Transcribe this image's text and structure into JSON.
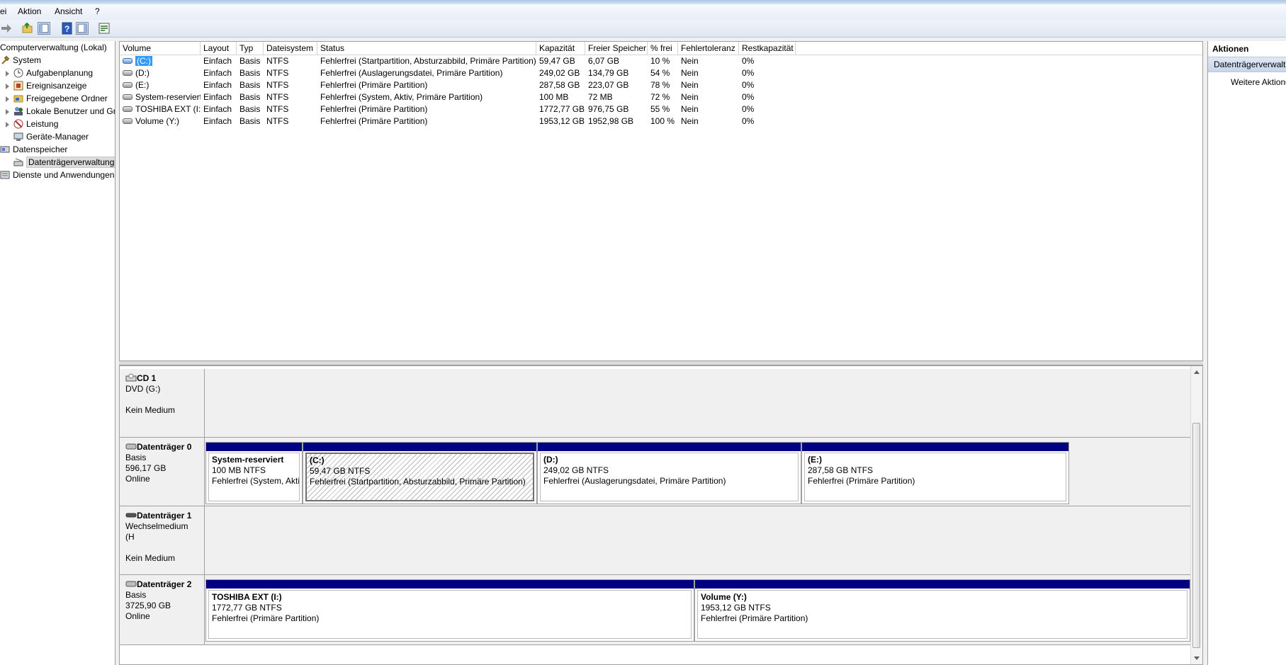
{
  "menu": [
    "ei",
    "Aktion",
    "Ansicht",
    "?"
  ],
  "tree": {
    "items": [
      {
        "label": "Computerverwaltung (Lokal)",
        "level": 0,
        "expander": false,
        "icon": "computer-icon"
      },
      {
        "label": "System",
        "level": 1,
        "expander": false,
        "icon": "tools-icon"
      },
      {
        "label": "Aufgabenplanung",
        "level": 2,
        "expander": true,
        "icon": "clock-icon"
      },
      {
        "label": "Ereignisanzeige",
        "level": 2,
        "expander": true,
        "icon": "event-log-icon"
      },
      {
        "label": "Freigegebene Ordner",
        "level": 2,
        "expander": true,
        "icon": "shared-folder-icon"
      },
      {
        "label": "Lokale Benutzer und Gru",
        "level": 2,
        "expander": true,
        "icon": "users-icon"
      },
      {
        "label": "Leistung",
        "level": 2,
        "expander": true,
        "icon": "performance-icon"
      },
      {
        "label": "Geräte-Manager",
        "level": 2,
        "expander": false,
        "icon": "device-manager-icon"
      },
      {
        "label": "Datenspeicher",
        "level": 1,
        "expander": false,
        "icon": "storage-icon"
      },
      {
        "label": "Datenträgerverwaltung",
        "level": 2,
        "expander": false,
        "icon": "disk-management-icon",
        "selected": true
      },
      {
        "label": "Dienste und Anwendungen",
        "level": 1,
        "expander": false,
        "icon": "services-icon"
      }
    ]
  },
  "volumes": {
    "columns": [
      "Volume",
      "Layout",
      "Typ",
      "Dateisystem",
      "Status",
      "Kapazität",
      "Freier Speicher",
      "% frei",
      "Fehlertoleranz",
      "Restkapazität"
    ],
    "rows": [
      [
        "(C:)",
        "Einfach",
        "Basis",
        "NTFS",
        "Fehlerfrei (Startpartition, Absturzabbild, Primäre Partition)",
        "59,47 GB",
        "6,07 GB",
        "10 %",
        "Nein",
        "0%"
      ],
      [
        "(D:)",
        "Einfach",
        "Basis",
        "NTFS",
        "Fehlerfrei (Auslagerungsdatei, Primäre Partition)",
        "249,02 GB",
        "134,79 GB",
        "54 %",
        "Nein",
        "0%"
      ],
      [
        "(E:)",
        "Einfach",
        "Basis",
        "NTFS",
        "Fehlerfrei (Primäre Partition)",
        "287,58 GB",
        "223,07 GB",
        "78 %",
        "Nein",
        "0%"
      ],
      [
        "System-reserviert",
        "Einfach",
        "Basis",
        "NTFS",
        "Fehlerfrei (System, Aktiv, Primäre Partition)",
        "100 MB",
        "72 MB",
        "72 %",
        "Nein",
        "0%"
      ],
      [
        "TOSHIBA EXT (I:)",
        "Einfach",
        "Basis",
        "NTFS",
        "Fehlerfrei (Primäre Partition)",
        "1772,77 GB",
        "976,75 GB",
        "55 %",
        "Nein",
        "0%"
      ],
      [
        "Volume (Y:)",
        "Einfach",
        "Basis",
        "NTFS",
        "Fehlerfrei (Primäre Partition)",
        "1953,12 GB",
        "1952,98 GB",
        "100 %",
        "Nein",
        "0%"
      ]
    ]
  },
  "disks": [
    {
      "name": "CD 1",
      "line2": "DVD (G:)",
      "line3": "",
      "line4": "Kein Medium",
      "partitions": []
    },
    {
      "name": "Datenträger 0",
      "line2": "Basis",
      "line3": "596,17 GB",
      "line4": "Online",
      "partitions": [
        {
          "name": "System-reserviert",
          "size": "100 MB NTFS",
          "status": "Fehlerfrei (System, Akti"
        },
        {
          "name": "(C:)",
          "size": "59,47 GB NTFS",
          "status": "Fehlerfrei (Startpartition, Absturzabbild, Primäre Partition)",
          "selected": true
        },
        {
          "name": "(D:)",
          "size": "249,02 GB NTFS",
          "status": "Fehlerfrei (Auslagerungsdatei, Primäre Partition)"
        },
        {
          "name": "(E:)",
          "size": "287,58 GB NTFS",
          "status": "Fehlerfrei (Primäre Partition)"
        }
      ]
    },
    {
      "name": "Datenträger 1",
      "line2": "Wechselmedium (H",
      "line3": "",
      "line4": "Kein Medium",
      "partitions": []
    },
    {
      "name": "Datenträger 2",
      "line2": "Basis",
      "line3": "3725,90 GB",
      "line4": "Online",
      "partitions": [
        {
          "name": "TOSHIBA EXT  (I:)",
          "size": "1772,77 GB NTFS",
          "status": "Fehlerfrei (Primäre Partition)"
        },
        {
          "name": "Volume  (Y:)",
          "size": "1953,12 GB NTFS",
          "status": "Fehlerfrei (Primäre Partition)"
        }
      ]
    }
  ],
  "actions": {
    "title": "Aktionen",
    "section": "Datenträgerverwaltung",
    "more": "Weitere Aktionen"
  }
}
